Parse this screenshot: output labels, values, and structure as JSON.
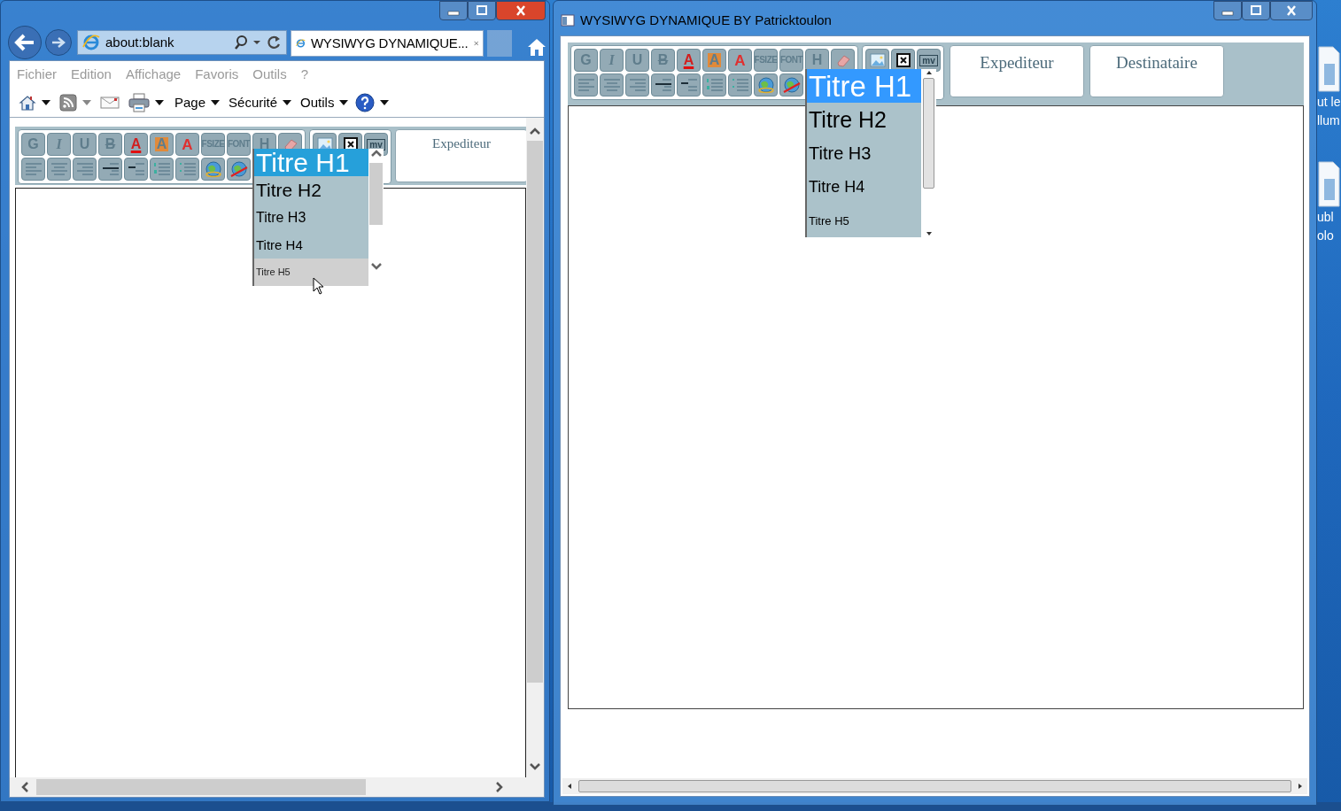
{
  "desktop": {
    "icons": [
      {
        "lines": [
          "ut le",
          "llum"
        ]
      },
      {
        "lines": [
          "ubl",
          "olo"
        ]
      }
    ]
  },
  "browser": {
    "address": "about:blank",
    "tab_title": "WYSIWYG DYNAMIQUE...",
    "menu": [
      "Fichier",
      "Edition",
      "Affichage",
      "Favoris",
      "Outils",
      "?"
    ],
    "commands": [
      {
        "kind": "icon",
        "caret": true
      },
      {
        "kind": "icon",
        "caret": true
      },
      {
        "kind": "icon",
        "caret": false
      },
      {
        "kind": "icon",
        "caret": true
      },
      {
        "kind": "text",
        "label": "Page",
        "caret": true
      },
      {
        "kind": "text",
        "label": "Sécurité",
        "caret": true
      },
      {
        "kind": "text",
        "label": "Outils",
        "caret": true
      },
      {
        "kind": "icon",
        "caret": true
      }
    ],
    "editor": {
      "format_buttons": [
        "G",
        "I",
        "U",
        "B",
        "A",
        "A",
        "A",
        "FSIZE",
        "FONT",
        "H"
      ],
      "media_label": "mv",
      "fields": [
        "Expediteur"
      ],
      "heading_menu": [
        {
          "kind": "h1",
          "label": "Titre H1",
          "selected": true,
          "hovered": false
        },
        {
          "kind": "h2",
          "label": "Titre H2",
          "selected": false,
          "hovered": false
        },
        {
          "kind": "h3",
          "label": "Titre H3",
          "selected": false,
          "hovered": false
        },
        {
          "kind": "h4",
          "label": "Titre H4",
          "selected": false,
          "hovered": false
        },
        {
          "kind": "h5",
          "label": "Titre H5",
          "selected": false,
          "hovered": true
        }
      ]
    }
  },
  "app_window": {
    "title": "WYSIWYG DYNAMIQUE BY Patricktoulon",
    "editor": {
      "format_buttons": [
        "G",
        "I",
        "U",
        "B",
        "A",
        "A",
        "A",
        "FSIZE",
        "FONT",
        "H"
      ],
      "media_label": "mv",
      "fields": [
        "Expediteur",
        "Destinataire"
      ],
      "heading_menu": [
        {
          "kind": "h1",
          "label": "Titre H1",
          "selected": true,
          "hovered": false
        },
        {
          "kind": "h2",
          "label": "Titre H2",
          "selected": false,
          "hovered": false
        },
        {
          "kind": "h3",
          "label": "Titre H3",
          "selected": false,
          "hovered": false
        },
        {
          "kind": "h4",
          "label": "Titre H4",
          "selected": false,
          "hovered": false
        },
        {
          "kind": "h5",
          "label": "Titre H5",
          "selected": false,
          "hovered": false
        }
      ]
    }
  }
}
